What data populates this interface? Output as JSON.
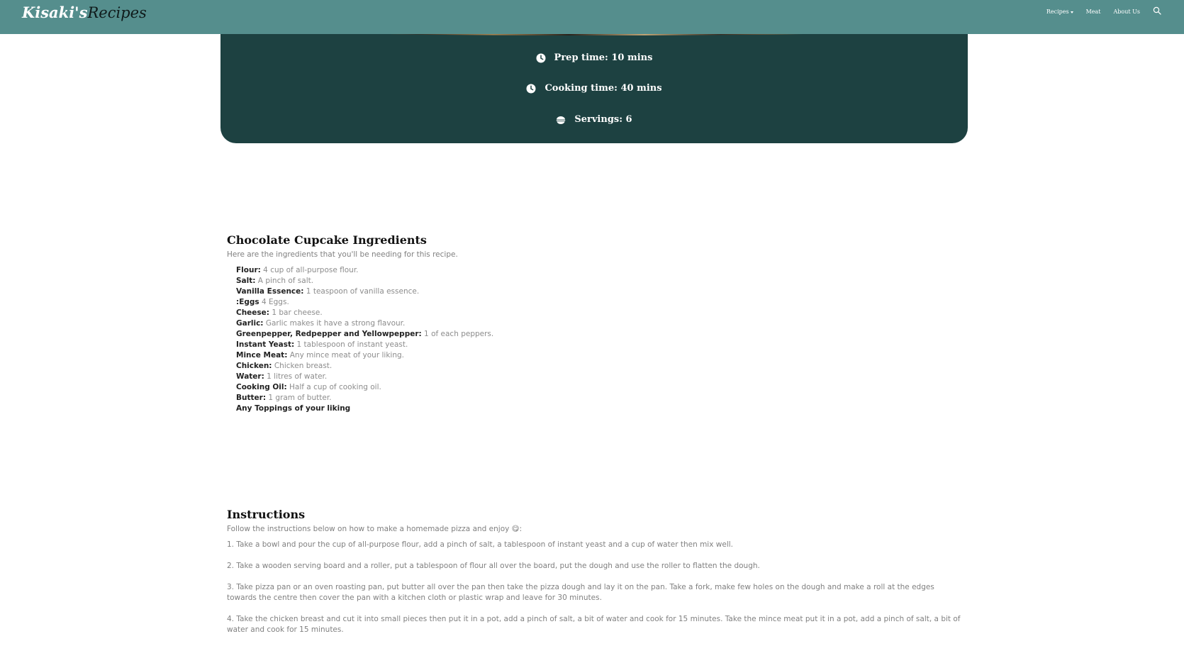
{
  "brand": {
    "part1": "Kisaki's",
    "part2": "Recipes"
  },
  "nav": {
    "recipes": "Recipes",
    "meat": "Meat",
    "about": "About Us"
  },
  "info": {
    "prep": "Prep time: 10 mins",
    "cook": "Cooking time: 40 mins",
    "servings": "Servings: 6"
  },
  "ingredients": {
    "title": "Chocolate Cupcake Ingredients",
    "subtitle": "Here are the ingredients that you'll be needing for this recipe.",
    "items": [
      {
        "name": "Flour:",
        "detail": " 4 cup of all-purpose flour."
      },
      {
        "name": "Salt:",
        "detail": " A pinch of salt."
      },
      {
        "name": "Vanilla Essence:",
        "detail": " 1 teaspoon of vanilla essence."
      },
      {
        "name": ":Eggs",
        "detail": " 4 Eggs."
      },
      {
        "name": "Cheese:",
        "detail": " 1 bar cheese."
      },
      {
        "name": "Garlic:",
        "detail": " Garlic makes it have a strong flavour."
      },
      {
        "name": "Greenpepper, Redpepper and Yellowpepper:",
        "detail": " 1 of each peppers."
      },
      {
        "name": "Instant Yeast:",
        "detail": " 1 tablespoon of instant yeast."
      },
      {
        "name": "Mince Meat:",
        "detail": " Any mince meat of your liking."
      },
      {
        "name": "Chicken:",
        "detail": " Chicken breast."
      },
      {
        "name": "Water:",
        "detail": " 1 litres of water."
      },
      {
        "name": "Cooking Oil:",
        "detail": " Half a cup of cooking oil."
      },
      {
        "name": "Butter:",
        "detail": " 1 gram of butter."
      },
      {
        "name": "Any Toppings of your liking",
        "detail": ""
      }
    ]
  },
  "instructions": {
    "title": "Instructions",
    "subtitle": "Follow the instructions below on how to make a homemade pizza and enjoy 😋:",
    "steps": [
      "1. Take a bowl and pour the cup of all-purpose flour, add a pinch of salt, a tablespoon of instant yeast and a cup of water then mix well.",
      "2. Take a wooden serving board and a roller, put a tablespoon of flour all over the board, put the dough and use the roller to flatten the dough.",
      "3. Take pizza pan or an oven roasting pan, put butter all over the pan then take the pizza dough and lay it on the pan. Take a fork, make few holes on the dough and make a roll at the edges towards the centre then cover the pan with a kitchen cloth or plastic wrap and leave for 30 minutes.",
      "4. Take the chicken breast and cut it into small pieces then put it in a pot, add a pinch of salt, a bit of water and cook for 15 minutes. Take the mince meat put it in a pot, add a pinch of salt, a bit of water and cook for 15 minutes."
    ]
  },
  "colors": {
    "navbar": "#558e8d",
    "card": "#1d4141"
  }
}
